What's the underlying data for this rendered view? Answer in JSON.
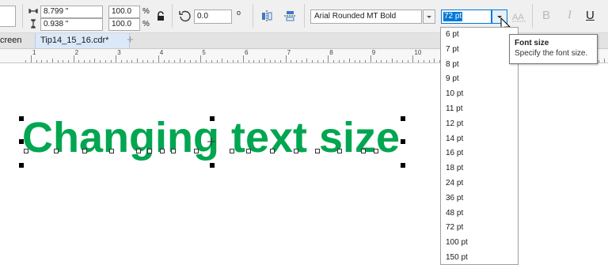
{
  "toolbar": {
    "width_value": "8.799 \"",
    "height_value": "0.938 \"",
    "scale_x": "100.0",
    "scale_y": "100.0",
    "percent_symbol": "%",
    "rotation_value": "0.0",
    "degree_symbol": "o",
    "font_family": "Arial Rounded MT Bold",
    "font_size": "72 pt",
    "bold_label": "B",
    "italic_label": "I",
    "underline_label": "U"
  },
  "tabs": {
    "partial_tab_label": "creen",
    "active_tab_label": "Tip14_15_16.cdr*",
    "add_tab_label": "+"
  },
  "ruler": {
    "labels": [
      "1",
      "2",
      "3",
      "4",
      "5",
      "6",
      "7",
      "8",
      "9",
      "10"
    ]
  },
  "canvas": {
    "text": "Changing text size",
    "text_color": "#00a650"
  },
  "dropdown": {
    "items": [
      "6 pt",
      "7 pt",
      "8 pt",
      "9 pt",
      "10 pt",
      "11 pt",
      "12 pt",
      "14 pt",
      "16 pt",
      "18 pt",
      "24 pt",
      "36 pt",
      "48 pt",
      "72 pt",
      "100 pt",
      "150 pt"
    ],
    "selected": "72 pt"
  },
  "tooltip": {
    "title": "Font size",
    "description": "Specify the font size."
  },
  "colors": {
    "selection_highlight": "#0078d7",
    "active_tab": "#dae8f8",
    "text_green": "#00a650"
  },
  "icons": [
    "width-icon",
    "height-icon",
    "lock-icon",
    "rotate-icon",
    "mirror-horizontal-icon",
    "mirror-vertical-icon",
    "dropdown-arrow-icon",
    "mouse-cursor-icon",
    "text-style-icon"
  ]
}
